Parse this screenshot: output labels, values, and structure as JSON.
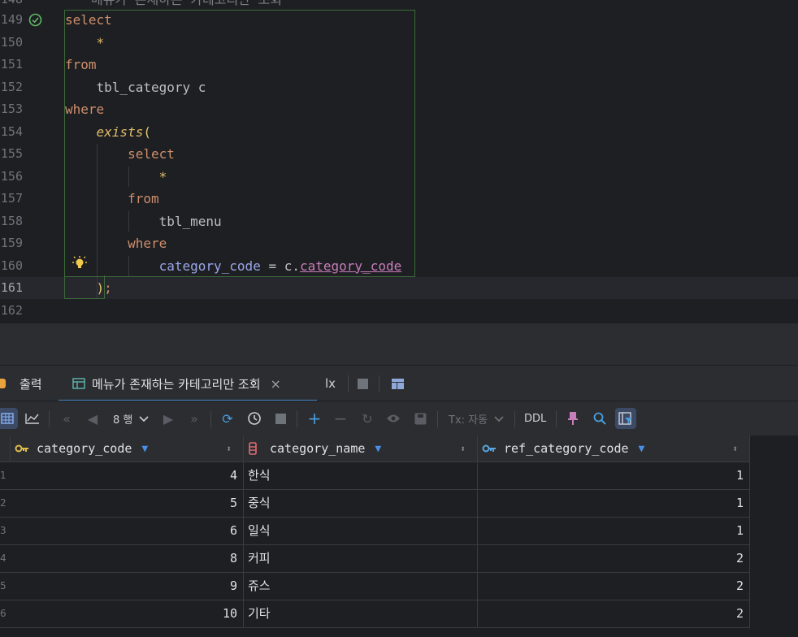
{
  "editor": {
    "comment_text": "메뉴가 존재하는 카테고리만 조회",
    "lines": [
      {
        "num": "149",
        "tokens": [
          {
            "t": "select",
            "c": "kw"
          }
        ]
      },
      {
        "num": "150",
        "tokens": [
          {
            "t": "    *",
            "c": "fnit"
          }
        ]
      },
      {
        "num": "151",
        "tokens": [
          {
            "t": "from",
            "c": "kw"
          }
        ]
      },
      {
        "num": "152",
        "tokens": [
          {
            "t": "    tbl_category c",
            "c": "plain"
          }
        ]
      },
      {
        "num": "153",
        "tokens": [
          {
            "t": "where",
            "c": "kw"
          }
        ]
      },
      {
        "num": "154",
        "tokens": [
          {
            "t": "    ",
            "c": "plain"
          },
          {
            "t": "exists",
            "c": "fnit"
          },
          {
            "t": "(",
            "c": "paren"
          }
        ]
      },
      {
        "num": "155",
        "tokens": [
          {
            "t": "        select",
            "c": "kw"
          }
        ]
      },
      {
        "num": "156",
        "tokens": [
          {
            "t": "            *",
            "c": "fnit"
          }
        ]
      },
      {
        "num": "157",
        "tokens": [
          {
            "t": "        from",
            "c": "kw"
          }
        ]
      },
      {
        "num": "158",
        "tokens": [
          {
            "t": "            tbl_menu",
            "c": "plain"
          }
        ]
      },
      {
        "num": "159",
        "tokens": [
          {
            "t": "        where",
            "c": "kw"
          }
        ]
      },
      {
        "num": "160",
        "tokens": [
          {
            "t": "            ",
            "c": "plain"
          },
          {
            "t": "category_code",
            "c": "col"
          },
          {
            "t": " = c.",
            "c": "plain"
          },
          {
            "t": "category_code",
            "c": "col-ul"
          }
        ]
      },
      {
        "num": "161",
        "tokens": [
          {
            "t": "    ",
            "c": "plain"
          },
          {
            "t": ")",
            "c": "paren"
          },
          {
            "t": ";",
            "c": "kw"
          }
        ]
      },
      {
        "num": "162",
        "tokens": []
      }
    ]
  },
  "tabs": {
    "output_label": "출력",
    "result_label": "메뉴가 존재하는 카테고리만 조회",
    "close_glyph": "×",
    "tx_glyph": "lx"
  },
  "toolbar": {
    "rows_label": "8 행",
    "tx_label": "Tx: 자동",
    "ddl_label": "DDL"
  },
  "grid": {
    "columns": [
      "category_code",
      "category_name",
      "ref_category_code"
    ],
    "rows": [
      {
        "n": "1",
        "category_code": "4",
        "category_name": "한식",
        "ref_category_code": "1"
      },
      {
        "n": "2",
        "category_code": "5",
        "category_name": "중식",
        "ref_category_code": "1"
      },
      {
        "n": "3",
        "category_code": "6",
        "category_name": "일식",
        "ref_category_code": "1"
      },
      {
        "n": "4",
        "category_code": "8",
        "category_name": "커피",
        "ref_category_code": "2"
      },
      {
        "n": "5",
        "category_code": "9",
        "category_name": "쥬스",
        "ref_category_code": "2"
      },
      {
        "n": "6",
        "category_code": "10",
        "category_name": "기타",
        "ref_category_code": "2"
      }
    ]
  }
}
